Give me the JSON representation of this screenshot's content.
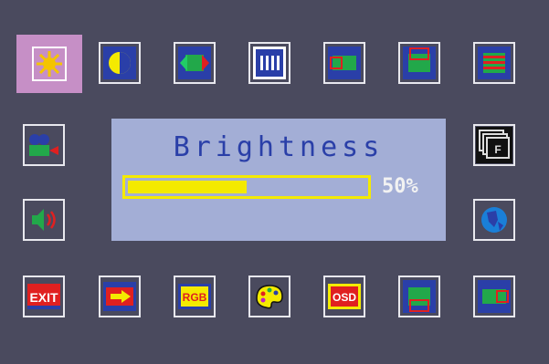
{
  "osd": {
    "title": "Brightness",
    "value_label": "50%",
    "value": 0.5
  },
  "buttons": {
    "exit": "EXIT",
    "rgb": "RGB",
    "osd": "OSD"
  },
  "colors": {
    "background": "#4a4a5e",
    "panel": "#a3aed6",
    "title": "#2a3fa8",
    "bar": "#f4ea00",
    "selected": "#c68fc6"
  }
}
